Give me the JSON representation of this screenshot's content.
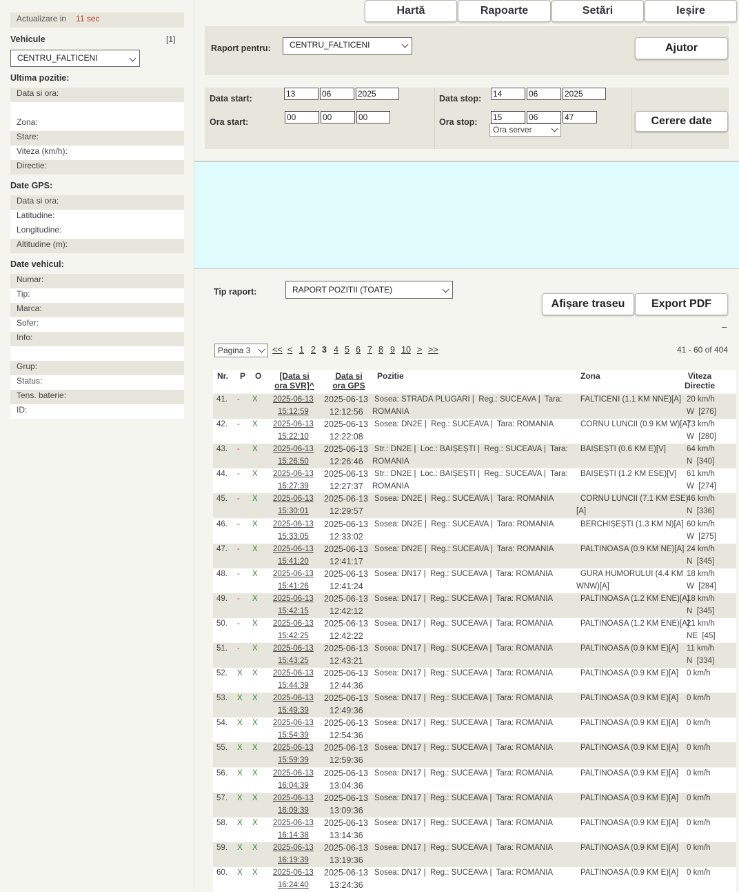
{
  "sidebar": {
    "update_label": "Actualizare in",
    "update_value": "11 sec",
    "vehicles_title": "Vehicule",
    "vehicles_count": "[1]",
    "vehicle_selected": "CENTRU_FALTICENI",
    "last_position_title": "Ultima pozitie:",
    "last_position_fields": [
      "Data si ora:",
      "",
      "Zona:",
      "Stare:",
      "Viteza (km/h):",
      "Directie:"
    ],
    "gps_title": "Date GPS:",
    "gps_fields": [
      "Data si ora:",
      "Latitudine:",
      "Longitudine:",
      "Altitudine (m):"
    ],
    "vehicle_title": "Date vehicul:",
    "vehicle_fields": [
      "Numar:",
      "Tip:",
      "Marca:",
      "Sofer:",
      "Info:",
      "",
      "Grup:",
      "Status:",
      "Tens. baterie:",
      "ID:"
    ]
  },
  "nav": {
    "map": "Hartă",
    "reports": "Rapoarte",
    "settings": "Setări",
    "exit": "Ieșire"
  },
  "form": {
    "report_for_label": "Raport pentru:",
    "report_for_value": "CENTRU_FALTICENI",
    "help_button": "Ajutor",
    "start_date_label": "Data start:",
    "start_day": "13",
    "start_month": "06",
    "start_year": "2025",
    "start_time_label": "Ora start:",
    "start_hour": "00",
    "start_min": "00",
    "start_sec": "00",
    "stop_date_label": "Data stop:",
    "stop_day": "14",
    "stop_month": "06",
    "stop_year": "2025",
    "stop_time_label": "Ora stop:",
    "stop_hour": "15",
    "stop_min": "06",
    "stop_sec": "47",
    "time_source": "Ora server",
    "request_button": "Cerere date"
  },
  "report": {
    "type_label": "Tip raport:",
    "type_value": "RAPORT POZITII (TOATE)",
    "show_route_button": "Afișare traseu",
    "export_pdf_button": "Export PDF",
    "collapse": "–"
  },
  "pagination": {
    "page_select": "Pagina 3",
    "first": "<<",
    "prev": "<",
    "pages": [
      "1",
      "2",
      "3",
      "4",
      "5",
      "6",
      "7",
      "8",
      "9",
      "10"
    ],
    "current": "3",
    "next": ">",
    "last": ">>",
    "range": "41 - 60 of 404"
  },
  "table": {
    "headers": {
      "nr": "Nr.",
      "p": "P",
      "o": "O",
      "svr_l1": "[Data si",
      "svr_l2": "ora SVR]^",
      "gps_l1": "Data si",
      "gps_l2": "ora GPS",
      "pos": "Pozitie",
      "zone": "Zona",
      "speed_l1": "Viteza",
      "speed_l2": "Directie"
    },
    "rows": [
      {
        "nr": "41.",
        "p": "-",
        "o": "X",
        "svr_date": "2025-06-13",
        "svr_time": "15:12:59",
        "gps_date": "2025-06-13",
        "gps_time": "12:12:56",
        "pos1": "Sosea: STRADA PLUGARI |  Reg.: SUCEAVA |  Tara:",
        "pos2": "ROMANIA",
        "zone1": "FALTICENI (1.1 KM NNE)[A]",
        "zone2": "",
        "speed": "20 km/h",
        "dir": "W  [276]"
      },
      {
        "nr": "42.",
        "p": "-",
        "o": "X",
        "svr_date": "2025-06-13",
        "svr_time": "15:22:10",
        "gps_date": "2025-06-13",
        "gps_time": "12:22:08",
        "pos1": "Sosea: DN2E |  Reg.: SUCEAVA |  Tara: ROMANIA",
        "pos2": "",
        "zone1": "CORNU LUNCII (0.9 KM W)[A]",
        "zone2": "",
        "speed": "73 km/h",
        "dir": "W  [280]"
      },
      {
        "nr": "43.",
        "p": "-",
        "o": "X",
        "svr_date": "2025-06-13",
        "svr_time": "15:26:50",
        "gps_date": "2025-06-13",
        "gps_time": "12:26:46",
        "pos1": "Str.: DN2E |  Loc.: BAIȘEȘTI |  Reg.: SUCEAVA |  Tara:",
        "pos2": "ROMANIA",
        "zone1": "BAIȘEȘTI (0.6 KM E)[V]",
        "zone2": "",
        "speed": "64 km/h",
        "dir": "N  [340]"
      },
      {
        "nr": "44.",
        "p": "-",
        "o": "X",
        "svr_date": "2025-06-13",
        "svr_time": "15:27:39",
        "gps_date": "2025-06-13",
        "gps_time": "12:27:37",
        "pos1": "Str.: DN2E |  Loc.: BAIȘEȘTI |  Reg.: SUCEAVA |  Tara:",
        "pos2": "ROMANIA",
        "zone1": "BAIȘEȘTI (1.2 KM ESE)[V]",
        "zone2": "",
        "speed": "61 km/h",
        "dir": "W  [274]"
      },
      {
        "nr": "45.",
        "p": "-",
        "o": "X",
        "svr_date": "2025-06-13",
        "svr_time": "15:30:01",
        "gps_date": "2025-06-13",
        "gps_time": "12:29:57",
        "pos1": "Sosea: DN2E |  Reg.: SUCEAVA |  Tara: ROMANIA",
        "pos2": "",
        "zone1": "CORNU LUNCII (7.1 KM ESE)",
        "zone2": "[A]",
        "speed": "46 km/h",
        "dir": "N  [336]"
      },
      {
        "nr": "46.",
        "p": "-",
        "o": "X",
        "svr_date": "2025-06-13",
        "svr_time": "15:33:05",
        "gps_date": "2025-06-13",
        "gps_time": "12:33:02",
        "pos1": "Sosea: DN2E |  Reg.: SUCEAVA |  Tara: ROMANIA",
        "pos2": "",
        "zone1": "BERCHIȘEȘTI (1.3 KM N)[A]",
        "zone2": "",
        "speed": "60 km/h",
        "dir": "W  [275]"
      },
      {
        "nr": "47.",
        "p": "-",
        "o": "X",
        "svr_date": "2025-06-13",
        "svr_time": "15:41:20",
        "gps_date": "2025-06-13",
        "gps_time": "12:41:17",
        "pos1": "Sosea: DN2E |  Reg.: SUCEAVA |  Tara: ROMANIA",
        "pos2": "",
        "zone1": "PALTINOASA (0.9 KM NE)[A]",
        "zone2": "",
        "speed": "24 km/h",
        "dir": "N  [345]"
      },
      {
        "nr": "48.",
        "p": "-",
        "o": "X",
        "svr_date": "2025-06-13",
        "svr_time": "15:41:26",
        "gps_date": "2025-06-13",
        "gps_time": "12:41:24",
        "pos1": "Sosea: DN17 |  Reg.: SUCEAVA |  Tara: ROMANIA",
        "pos2": "",
        "zone1": "GURA HUMORULUI (4.4 KM",
        "zone2": "WNW)[A]",
        "speed": "18 km/h",
        "dir": "W  [284]"
      },
      {
        "nr": "49.",
        "p": "-",
        "o": "X",
        "svr_date": "2025-06-13",
        "svr_time": "15:42:15",
        "gps_date": "2025-06-13",
        "gps_time": "12:42:12",
        "pos1": "Sosea: DN17 |  Reg.: SUCEAVA |  Tara: ROMANIA",
        "pos2": "",
        "zone1": "PALTINOASA (1.2 KM ENE)[A]",
        "zone2": "",
        "speed": "18 km/h",
        "dir": "N  [345]"
      },
      {
        "nr": "50.",
        "p": "-",
        "o": "X",
        "svr_date": "2025-06-13",
        "svr_time": "15:42:25",
        "gps_date": "2025-06-13",
        "gps_time": "12:42:22",
        "pos1": "Sosea: DN17 |  Reg.: SUCEAVA |  Tara: ROMANIA",
        "pos2": "",
        "zone1": "PALTINOASA (1.2 KM ENE)[A]",
        "zone2": "",
        "speed": "21 km/h",
        "dir": "NE  [45]"
      },
      {
        "nr": "51.",
        "p": "-",
        "o": "X",
        "svr_date": "2025-06-13",
        "svr_time": "15:43:25",
        "gps_date": "2025-06-13",
        "gps_time": "12:43:21",
        "pos1": "Sosea: DN17 |  Reg.: SUCEAVA |  Tara: ROMANIA",
        "pos2": "",
        "zone1": "PALTINOASA (0.9 KM E)[A]",
        "zone2": "",
        "speed": "11 km/h",
        "dir": "N  [334]"
      },
      {
        "nr": "52.",
        "p": "X",
        "o": "X",
        "svr_date": "2025-06-13",
        "svr_time": "15:44:39",
        "gps_date": "2025-06-13",
        "gps_time": "12:44:36",
        "pos1": "Sosea: DN17 |  Reg.: SUCEAVA |  Tara: ROMANIA",
        "pos2": "",
        "zone1": "PALTINOASA (0.9 KM E)[A]",
        "zone2": "",
        "speed": "0 km/h",
        "dir": ""
      },
      {
        "nr": "53.",
        "p": "X",
        "o": "X",
        "svr_date": "2025-06-13",
        "svr_time": "15:49:39",
        "gps_date": "2025-06-13",
        "gps_time": "12:49:36",
        "pos1": "Sosea: DN17 |  Reg.: SUCEAVA |  Tara: ROMANIA",
        "pos2": "",
        "zone1": "PALTINOASA (0.9 KM E)[A]",
        "zone2": "",
        "speed": "0 km/h",
        "dir": ""
      },
      {
        "nr": "54.",
        "p": "X",
        "o": "X",
        "svr_date": "2025-06-13",
        "svr_time": "15:54:39",
        "gps_date": "2025-06-13",
        "gps_time": "12:54:36",
        "pos1": "Sosea: DN17 |  Reg.: SUCEAVA |  Tara: ROMANIA",
        "pos2": "",
        "zone1": "PALTINOASA (0.9 KM E)[A]",
        "zone2": "",
        "speed": "0 km/h",
        "dir": ""
      },
      {
        "nr": "55.",
        "p": "X",
        "o": "X",
        "svr_date": "2025-06-13",
        "svr_time": "15:59:39",
        "gps_date": "2025-06-13",
        "gps_time": "12:59:36",
        "pos1": "Sosea: DN17 |  Reg.: SUCEAVA |  Tara: ROMANIA",
        "pos2": "",
        "zone1": "PALTINOASA (0.9 KM E)[A]",
        "zone2": "",
        "speed": "0 km/h",
        "dir": ""
      },
      {
        "nr": "56.",
        "p": "X",
        "o": "X",
        "svr_date": "2025-06-13",
        "svr_time": "16:04:39",
        "gps_date": "2025-06-13",
        "gps_time": "13:04:36",
        "pos1": "Sosea: DN17 |  Reg.: SUCEAVA |  Tara: ROMANIA",
        "pos2": "",
        "zone1": "PALTINOASA (0.9 KM E)[A]",
        "zone2": "",
        "speed": "0 km/h",
        "dir": ""
      },
      {
        "nr": "57.",
        "p": "X",
        "o": "X",
        "svr_date": "2025-06-13",
        "svr_time": "16:09:39",
        "gps_date": "2025-06-13",
        "gps_time": "13:09:36",
        "pos1": "Sosea: DN17 |  Reg.: SUCEAVA |  Tara: ROMANIA",
        "pos2": "",
        "zone1": "PALTINOASA (0.9 KM E)[A]",
        "zone2": "",
        "speed": "0 km/h",
        "dir": ""
      },
      {
        "nr": "58.",
        "p": "X",
        "o": "X",
        "svr_date": "2025-06-13",
        "svr_time": "16:14:38",
        "gps_date": "2025-06-13",
        "gps_time": "13:14:36",
        "pos1": "Sosea: DN17 |  Reg.: SUCEAVA |  Tara: ROMANIA",
        "pos2": "",
        "zone1": "PALTINOASA (0.9 KM E)[A]",
        "zone2": "",
        "speed": "0 km/h",
        "dir": ""
      },
      {
        "nr": "59.",
        "p": "X",
        "o": "X",
        "svr_date": "2025-06-13",
        "svr_time": "16:19:39",
        "gps_date": "2025-06-13",
        "gps_time": "13:19:36",
        "pos1": "Sosea: DN17 |  Reg.: SUCEAVA |  Tara: ROMANIA",
        "pos2": "",
        "zone1": "PALTINOASA (0.9 KM E)[A]",
        "zone2": "",
        "speed": "0 km/h",
        "dir": ""
      },
      {
        "nr": "60.",
        "p": "X",
        "o": "X",
        "svr_date": "2025-06-13",
        "svr_time": "16:24:40",
        "gps_date": "2025-06-13",
        "gps_time": "13:24:36",
        "pos1": "Sosea: DN17 |  Reg.: SUCEAVA |  Tara: ROMANIA",
        "pos2": "",
        "zone1": "PALTINOASA (0.9 KM E)[A]",
        "zone2": "",
        "speed": "0 km/h",
        "dir": ""
      }
    ]
  }
}
